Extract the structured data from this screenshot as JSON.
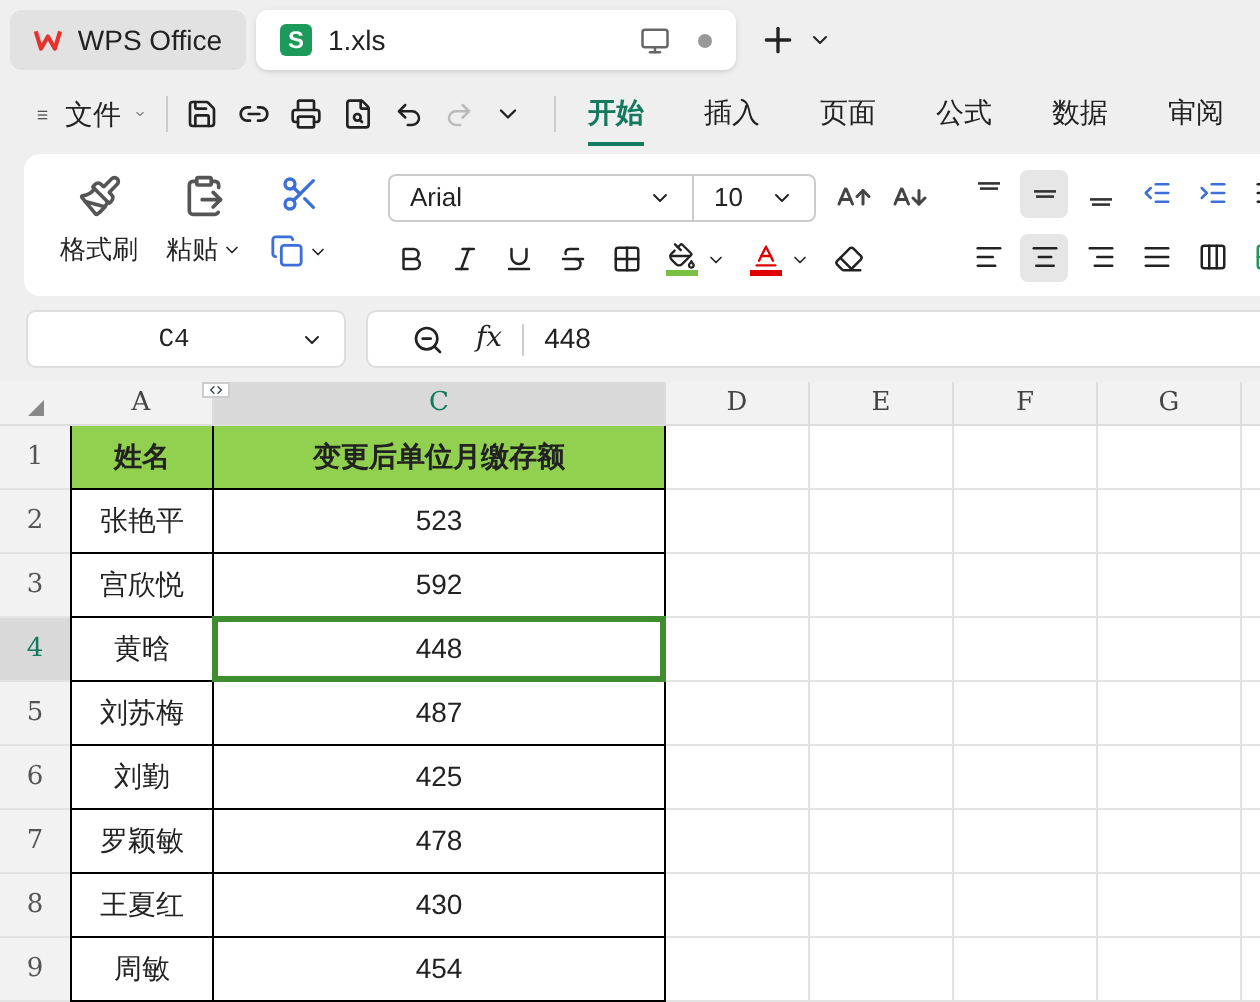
{
  "tabs": [
    {
      "label": "WPS Office",
      "kind": "home",
      "selected": false
    },
    {
      "label": "1.xls",
      "kind": "sheet",
      "badge": "S",
      "selected": true
    }
  ],
  "menu": {
    "file": "文件",
    "ribbon_tabs": [
      {
        "label": "开始",
        "selected": true
      },
      {
        "label": "插入",
        "selected": false
      },
      {
        "label": "页面",
        "selected": false
      },
      {
        "label": "公式",
        "selected": false
      },
      {
        "label": "数据",
        "selected": false
      },
      {
        "label": "审阅",
        "selected": false
      }
    ]
  },
  "ribbon": {
    "format_painter": "格式刷",
    "paste": "粘贴",
    "font": "Arial",
    "font_size": "10",
    "vertical_align": [
      {
        "selected": false
      },
      {
        "selected": true
      },
      {
        "selected": false
      }
    ],
    "horizontal_align": [
      {
        "selected": false
      },
      {
        "selected": true
      },
      {
        "selected": false
      },
      {
        "selected": false
      }
    ]
  },
  "formula_bar": {
    "cell": "C4",
    "function_label": "fx",
    "value": "448"
  },
  "sheet": {
    "columns": [
      {
        "label": "A",
        "selected": false
      },
      {
        "label": "C",
        "selected": true
      },
      {
        "label": "D",
        "selected": false
      },
      {
        "label": "E",
        "selected": false
      },
      {
        "label": "F",
        "selected": false
      },
      {
        "label": "G",
        "selected": false
      }
    ],
    "rows": [
      {
        "number": "1",
        "kind": "header",
        "selected": false,
        "cells": [
          "姓名",
          "变更后单位月缴存额"
        ]
      },
      {
        "number": "2",
        "kind": "data",
        "selected": false,
        "cells": [
          "张艳平",
          "523"
        ]
      },
      {
        "number": "3",
        "kind": "data",
        "selected": false,
        "cells": [
          "宫欣悦",
          "592"
        ]
      },
      {
        "number": "4",
        "kind": "data",
        "selected": true,
        "cells": [
          "黄晗",
          "448"
        ]
      },
      {
        "number": "5",
        "kind": "data",
        "selected": false,
        "cells": [
          "刘苏梅",
          "487"
        ]
      },
      {
        "number": "6",
        "kind": "data",
        "selected": false,
        "cells": [
          "刘勤",
          "425"
        ]
      },
      {
        "number": "7",
        "kind": "data",
        "selected": false,
        "cells": [
          "罗颖敏",
          "478"
        ]
      },
      {
        "number": "8",
        "kind": "data",
        "selected": false,
        "cells": [
          "王夏红",
          "430"
        ]
      },
      {
        "number": "9",
        "kind": "data",
        "selected": false,
        "cells": [
          "周敏",
          "454"
        ]
      }
    ]
  }
}
